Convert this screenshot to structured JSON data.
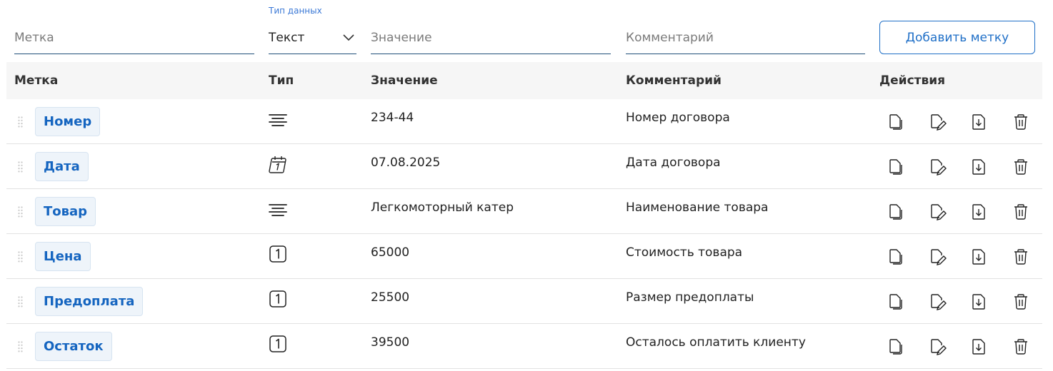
{
  "form": {
    "label_placeholder": "Метка",
    "type_caption": "Тип данных",
    "type_selected": "Текст",
    "value_placeholder": "Значение",
    "comment_placeholder": "Комментарий",
    "add_button": "Добавить метку"
  },
  "table": {
    "headers": {
      "label": "Метка",
      "type": "Тип",
      "value": "Значение",
      "comment": "Комментарий",
      "actions": "Действия"
    },
    "rows": [
      {
        "label": "Номер",
        "type_icon": "text-type-icon",
        "value": "234-44",
        "comment": "Номер договора"
      },
      {
        "label": "Дата",
        "type_icon": "date-type-icon",
        "value": "07.08.2025",
        "comment": "Дата договора"
      },
      {
        "label": "Товар",
        "type_icon": "text-type-icon",
        "value": "Легкомоторный катер",
        "comment": "Наименование товара"
      },
      {
        "label": "Цена",
        "type_icon": "number-type-icon",
        "value": "65000",
        "comment": "Стоимость товара"
      },
      {
        "label": "Предоплата",
        "type_icon": "number-type-icon",
        "value": "25500",
        "comment": "Размер предоплаты"
      },
      {
        "label": "Остаток",
        "type_icon": "number-type-icon",
        "value": "39500",
        "comment": "Осталось оплатить клиенту"
      }
    ],
    "row_actions": [
      "copy-icon",
      "edit-icon",
      "insert-icon",
      "delete-icon"
    ]
  },
  "colors": {
    "accent": "#1f6fc7",
    "tag_text": "#1565c0",
    "tag_bg": "#eef4fa",
    "header_bg": "#f6f6f6",
    "caption": "#3a78d6"
  }
}
